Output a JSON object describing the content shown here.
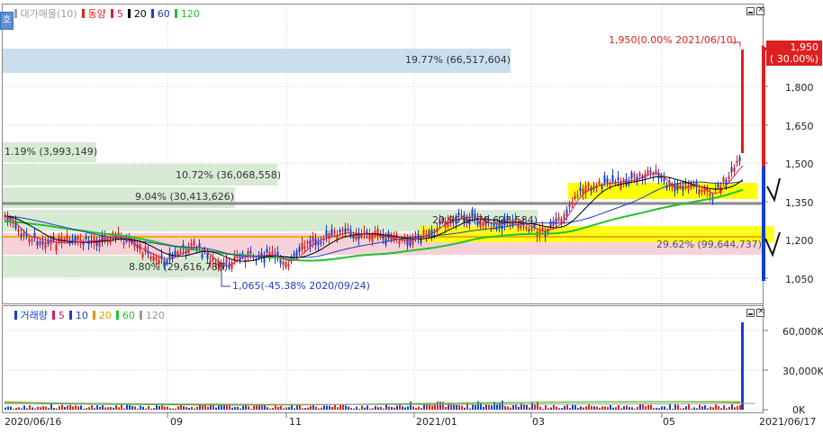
{
  "colors": {
    "up": "#e02020",
    "down": "#1040d0",
    "ma5": "#d81b60",
    "ma20": "#000000",
    "ma60": "#1f3fbf",
    "ma120": "#22c22e",
    "vol_ma5": "#d81b60",
    "vol_ma10": "#1f3fbf",
    "vol_ma20": "#e69500",
    "vol_ma60": "#22c22e",
    "vol_ma120": "#999999"
  },
  "price_panel": {
    "legend": [
      {
        "name": "대가매물(10)",
        "color": "#9aa0a6"
      },
      {
        "name": "동양",
        "color": "#e02020"
      },
      {
        "name": "5",
        "color": "#d81b60"
      },
      {
        "name": "20",
        "color": "#000000"
      },
      {
        "name": "60",
        "color": "#1f3fbf"
      },
      {
        "name": "120",
        "color": "#22c22e"
      }
    ],
    "side_button": "호",
    "y_ticks": [
      "1,800",
      "1,650",
      "1,500",
      "1,350",
      "1,200",
      "1,050"
    ],
    "current_price": "1,950",
    "current_change": "( 30.00%)",
    "high_annotation": "1,950(0.00% 2021/06/10)",
    "low_annotation": "1,065(-45.38% 2020/09/24)",
    "volume_profile": [
      {
        "label": "19.77% (66,517,604)",
        "style": "blue"
      },
      {
        "label": "1.19% (3,993,149)",
        "style": "green"
      },
      {
        "label": "10.72% (36,068,558)",
        "style": "green"
      },
      {
        "label": "9.04% (30,413,626)",
        "style": "green"
      },
      {
        "label": "20.99% (70,623,584)",
        "style": "green"
      },
      {
        "label": "8.80% (29,616,786)",
        "style": "green"
      },
      {
        "label": "29.62% (99,644,737)",
        "style": "pink"
      }
    ]
  },
  "volume_panel": {
    "legend": [
      {
        "name": "거래량",
        "color": "#1040d0"
      },
      {
        "name": "5",
        "color": "#d81b60"
      },
      {
        "name": "10",
        "color": "#1f3fbf"
      },
      {
        "name": "20",
        "color": "#e69500"
      },
      {
        "name": "60",
        "color": "#22c22e"
      },
      {
        "name": "120",
        "color": "#999999"
      }
    ],
    "y_ticks": [
      "60,000K",
      "30,000K",
      "0K"
    ]
  },
  "x_axis": {
    "labels": [
      "2020/06/16",
      "09",
      "11",
      "2021/01",
      "03",
      "05"
    ],
    "end_label": "2021/06/17"
  }
}
